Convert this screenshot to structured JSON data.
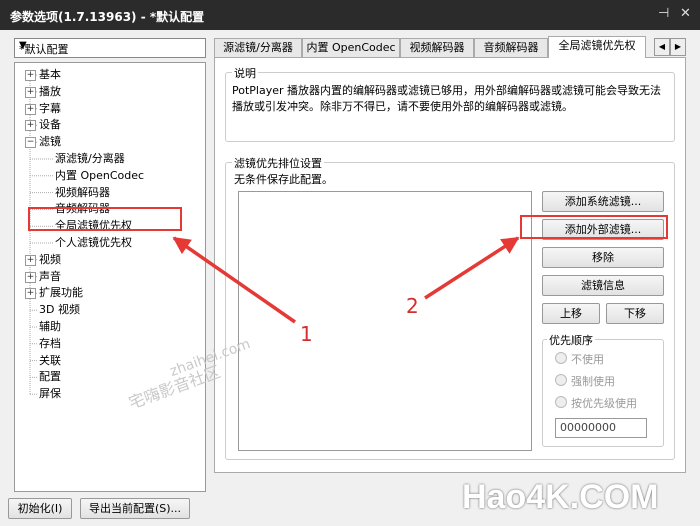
{
  "window": {
    "title": "参数选项(1.7.13963) - *默认配置",
    "pin": "⊣",
    "close": "✕"
  },
  "profile": {
    "selected": "*默认配置"
  },
  "tree": [
    {
      "label": "基本",
      "exp": "+",
      "depth": 0
    },
    {
      "label": "播放",
      "exp": "+",
      "depth": 0
    },
    {
      "label": "字幕",
      "exp": "+",
      "depth": 0
    },
    {
      "label": "设备",
      "exp": "+",
      "depth": 0
    },
    {
      "label": "滤镜",
      "exp": "−",
      "depth": 0
    },
    {
      "label": "源滤镜/分离器",
      "exp": "",
      "depth": 1
    },
    {
      "label": "内置 OpenCodec",
      "exp": "",
      "depth": 1
    },
    {
      "label": "视频解码器",
      "exp": "",
      "depth": 1
    },
    {
      "label": "音频解码器",
      "exp": "",
      "depth": 1
    },
    {
      "label": "全局滤镜优先权",
      "exp": "",
      "depth": 1
    },
    {
      "label": "个人滤镜优先权",
      "exp": "",
      "depth": 1
    },
    {
      "label": "视频",
      "exp": "+",
      "depth": 0
    },
    {
      "label": "声音",
      "exp": "+",
      "depth": 0
    },
    {
      "label": "扩展功能",
      "exp": "+",
      "depth": 0
    },
    {
      "label": "3D 视频",
      "exp": "",
      "depth": 0
    },
    {
      "label": "辅助",
      "exp": "",
      "depth": 0
    },
    {
      "label": "存档",
      "exp": "",
      "depth": 0
    },
    {
      "label": "关联",
      "exp": "",
      "depth": 0
    },
    {
      "label": "配置",
      "exp": "",
      "depth": 0
    },
    {
      "label": "屏保",
      "exp": "",
      "depth": 0
    }
  ],
  "tabs": [
    "源滤镜/分离器",
    "内置 OpenCodec",
    "视频解码器",
    "音频解码器",
    "全局滤镜优先权"
  ],
  "tab_arrows": {
    "prev": "◀",
    "next": "▶"
  },
  "description": {
    "title": "说明",
    "line1": "PotPlayer 播放器内置的编解码器或滤镜已够用，用外部编解码器或滤镜可能会导致无法",
    "line2": "播放或引发冲突。除非万不得已，请不要使用外部的编解码器或滤镜。"
  },
  "priority": {
    "title": "滤镜优先排位设置",
    "note": "无条件保存此配置。",
    "buttons": {
      "add_system": "添加系统滤镜...",
      "add_external": "添加外部滤镜...",
      "remove": "移除",
      "info": "滤镜信息",
      "up": "上移",
      "down": "下移"
    },
    "order": {
      "title": "优先顺序",
      "options": [
        "不使用",
        "强制使用",
        "按优先级使用"
      ],
      "value": "00000000"
    }
  },
  "footer": {
    "reset": "初始化(I)",
    "export": "导出当前配置(S)..."
  },
  "annotations": {
    "one": "1",
    "two": "2"
  },
  "watermark": {
    "logo": "Hao4K.COM",
    "site": "宅嗨影音社区",
    "url": "zhaihei.com"
  }
}
